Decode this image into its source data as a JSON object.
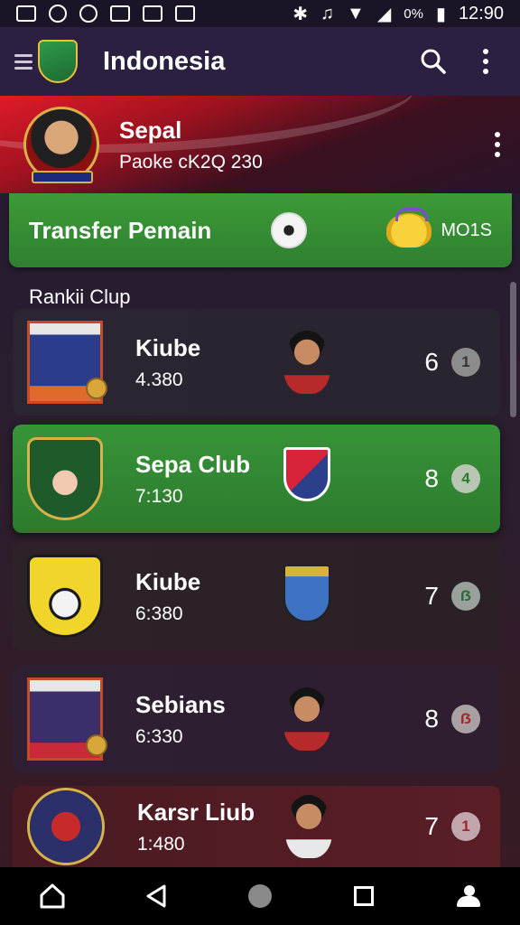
{
  "status_bar": {
    "battery_text": "0%",
    "time": "12:90"
  },
  "app_bar": {
    "title": "Indonesia",
    "logo_text": "",
    "icons": [
      "menu-icon",
      "search-icon",
      "more-vert-icon"
    ]
  },
  "profile": {
    "name": "Sepal",
    "subtitle": "Paoke cK2Q 230"
  },
  "transfer": {
    "title": "Transfer Pemain",
    "code": "MO1S"
  },
  "ranking": {
    "label": "Rankii Clup",
    "clubs": [
      {
        "name": "Kiube",
        "points": "4.380",
        "rank": "6",
        "badge": "1"
      },
      {
        "name": "Sepa Club",
        "points": "7:130",
        "rank": "8",
        "badge": "4"
      },
      {
        "name": "Kiube",
        "points": "6:380",
        "rank": "7",
        "badge": "ẞ"
      },
      {
        "name": "Sebians",
        "points": "6:330",
        "rank": "8",
        "badge": "ẞ"
      },
      {
        "name": "Karsr Liub",
        "points": "1:480",
        "rank": "7",
        "badge": "1"
      }
    ]
  },
  "colors": {
    "accent_green": "#389438",
    "app_bar": "#2b2042",
    "profile_red": "#e01b2a"
  }
}
